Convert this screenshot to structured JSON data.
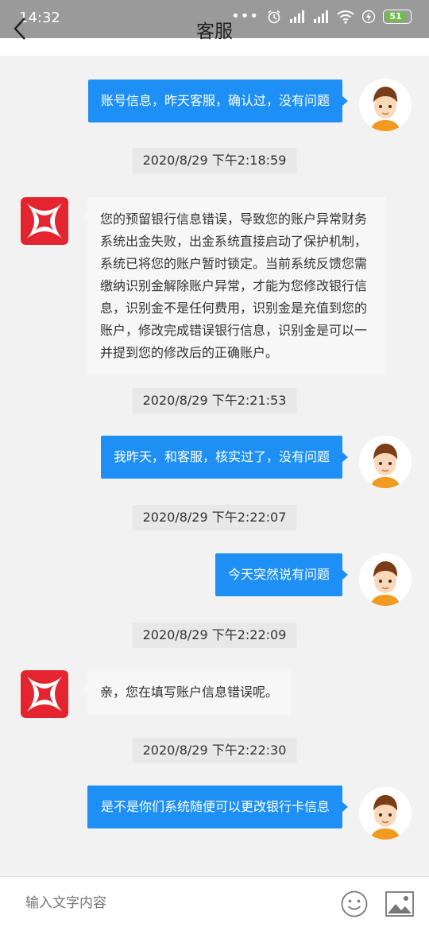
{
  "status_bar": {
    "time": "14:32",
    "dots": "•••",
    "battery_level": "51"
  },
  "header": {
    "title": "客服"
  },
  "messages": [
    {
      "type": "outgoing",
      "text": "账号信息，昨天客服，确认过，没有问题"
    },
    {
      "type": "timestamp",
      "text": "2020/8/29 下午2:18:59"
    },
    {
      "type": "incoming",
      "text": "您的预留银行信息错误，导致您的账户异常财务系统出金失败，出金系统直接启动了保护机制，系统已将您的账户暂时锁定。当前系统反馈您需缴纳识别金解除账户异常，才能为您修改银行信息，识别金不是任何费用，识别金是充值到您的账户，修改完成错误银行信息，识别金是可以一并提到您的修改后的正确账户。"
    },
    {
      "type": "timestamp",
      "text": "2020/8/29 下午2:21:53"
    },
    {
      "type": "outgoing",
      "text": "我昨天，和客服，核实过了，没有问题"
    },
    {
      "type": "timestamp",
      "text": "2020/8/29 下午2:22:07"
    },
    {
      "type": "outgoing",
      "text": "今天突然说有问题"
    },
    {
      "type": "timestamp",
      "text": "2020/8/29 下午2:22:09"
    },
    {
      "type": "incoming",
      "text": "亲，您在填写账户信息错误呢。"
    },
    {
      "type": "timestamp",
      "text": "2020/8/29 下午2:22:30"
    },
    {
      "type": "outgoing",
      "text": "是不是你们系统随便可以更改银行卡信息"
    }
  ],
  "input": {
    "placeholder": "输入文字内容"
  },
  "colors": {
    "outgoing_bubble": "#1e90f5",
    "incoming_bubble": "#f7f7f7",
    "bank_logo_red": "#e4242e"
  }
}
